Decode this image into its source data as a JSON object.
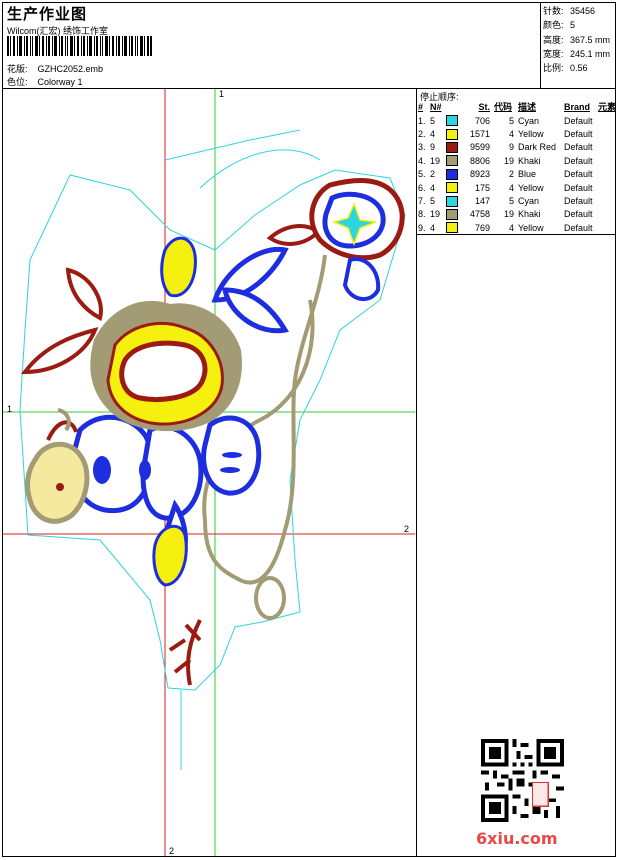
{
  "header": {
    "title": "生产作业图",
    "subtitle": "Wilcom(汇宏) 绣饰工作室",
    "design_label": "花版:",
    "design_value": "GZHC2052.emb",
    "colorway_label": "色位:",
    "colorway_value": "Colorway 1"
  },
  "stats": [
    {
      "label": "针数:",
      "value": "35456"
    },
    {
      "label": "颜色:",
      "value": "5"
    },
    {
      "label": "高度:",
      "value": "367.5 mm"
    },
    {
      "label": "宽度:",
      "value": "245.1 mm"
    },
    {
      "label": "比例:",
      "value": "0.56"
    }
  ],
  "stop_sequence": {
    "title": "停止顺序:",
    "headers": [
      "#",
      "N#",
      "St.",
      "代码",
      "描述",
      "Brand",
      "元素"
    ],
    "rows": [
      {
        "idx": "1.",
        "n": "5",
        "color": "#2ad6e0",
        "st": "706",
        "code": "5",
        "desc": "Cyan",
        "brand": "Default"
      },
      {
        "idx": "2.",
        "n": "4",
        "color": "#f6f00e",
        "st": "1571",
        "code": "4",
        "desc": "Yellow",
        "brand": "Default"
      },
      {
        "idx": "3.",
        "n": "9",
        "color": "#9b1b12",
        "st": "9599",
        "code": "9",
        "desc": "Dark Red",
        "brand": "Default"
      },
      {
        "idx": "4.",
        "n": "19",
        "color": "#a29b73",
        "st": "8806",
        "code": "19",
        "desc": "Khaki",
        "brand": "Default"
      },
      {
        "idx": "5.",
        "n": "2",
        "color": "#1d2de0",
        "st": "8923",
        "code": "2",
        "desc": "Blue",
        "brand": "Default"
      },
      {
        "idx": "6.",
        "n": "4",
        "color": "#f6f00e",
        "st": "175",
        "code": "4",
        "desc": "Yellow",
        "brand": "Default"
      },
      {
        "idx": "7.",
        "n": "5",
        "color": "#2ad6e0",
        "st": "147",
        "code": "5",
        "desc": "Cyan",
        "brand": "Default"
      },
      {
        "idx": "8.",
        "n": "19",
        "color": "#a29b73",
        "st": "4758",
        "code": "19",
        "desc": "Khaki",
        "brand": "Default"
      },
      {
        "idx": "9.",
        "n": "4",
        "color": "#f6f00e",
        "st": "769",
        "code": "4",
        "desc": "Yellow",
        "brand": "Default"
      }
    ]
  },
  "axes": {
    "green_label_top": "1",
    "green_label_left": "1",
    "red_label_right": "2",
    "red_label_bottom": "2"
  },
  "watermark": "6xiu.com",
  "colors": {
    "cyan": "#2ad6e0",
    "yellow": "#f6f00e",
    "dark_red": "#9b1b12",
    "khaki": "#a29b73",
    "blue": "#1d2de0",
    "green_axis": "#2bd12b",
    "red_axis": "#e21c1c"
  }
}
